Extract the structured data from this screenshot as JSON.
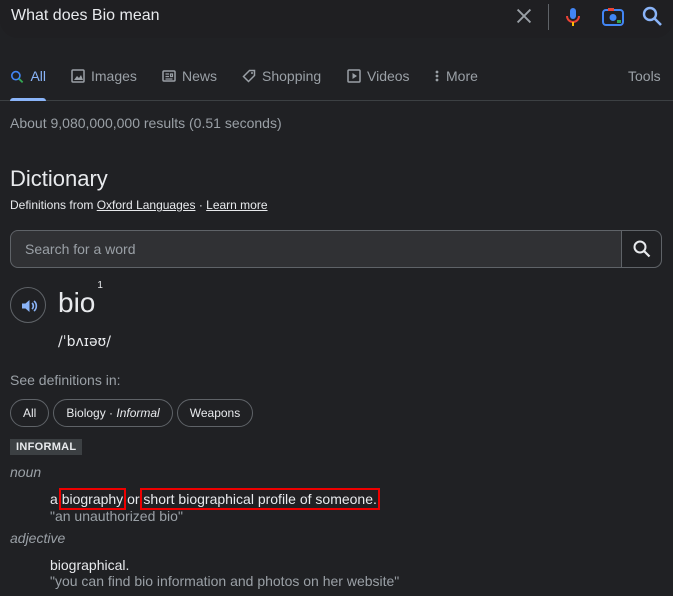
{
  "search": {
    "query": "What does Bio mean"
  },
  "tabs": [
    {
      "label": "All",
      "icon": "search-icon",
      "active": true
    },
    {
      "label": "Images",
      "icon": "image-icon"
    },
    {
      "label": "News",
      "icon": "news-icon"
    },
    {
      "label": "Shopping",
      "icon": "tag-icon"
    },
    {
      "label": "Videos",
      "icon": "video-icon"
    },
    {
      "label": "More",
      "icon": "more-vert-icon"
    }
  ],
  "tools_label": "Tools",
  "result_stats": "About 9,080,000,000 results (0.51 seconds)",
  "dictionary": {
    "title": "Dictionary",
    "source_prefix": "Definitions from",
    "source_name": "Oxford Languages",
    "separator": "·",
    "learn_more": "Learn more",
    "word_search_placeholder": "Search for a word",
    "headword": "bio",
    "superscript": "1",
    "phonetic": "/ˈbʌɪəʊ/",
    "see_definitions_label": "See definitions in:",
    "chips": [
      {
        "label": "All"
      },
      {
        "label": "Biology",
        "separator": " · ",
        "qualifier": "Informal"
      },
      {
        "label": "Weapons"
      }
    ],
    "register_badge": "INFORMAL",
    "senses": [
      {
        "pos": "noun",
        "def_prefix": "a",
        "def_part1": "biography",
        "def_middle": "or",
        "def_part2": "short biographical profile of someone.",
        "example": "\"an unauthorized bio\""
      },
      {
        "pos": "adjective",
        "definition": "biographical.",
        "example": "\"you can find bio information and photos on her website\""
      }
    ]
  },
  "colors": {
    "background": "#202124",
    "accent": "#8ab4f8",
    "highlight": "#ee0000"
  }
}
